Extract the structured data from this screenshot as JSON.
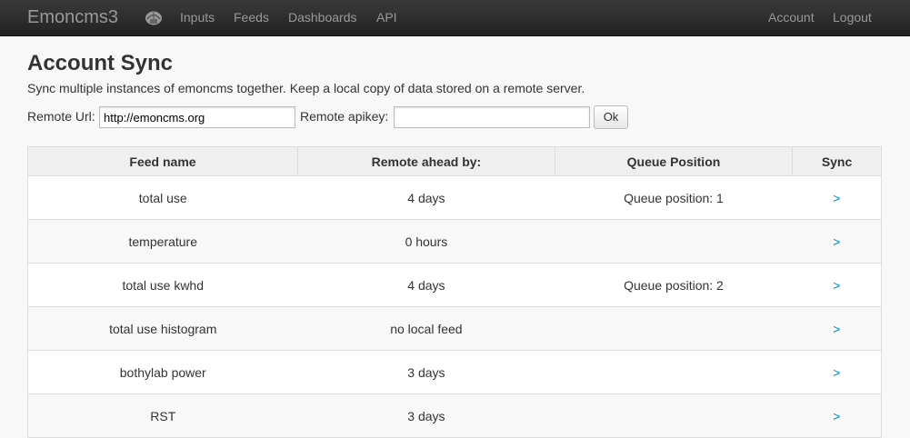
{
  "navbar": {
    "brand": "Emoncms3",
    "logo_icon": "helmet-icon",
    "links": [
      "Inputs",
      "Feeds",
      "Dashboards",
      "API"
    ],
    "right_links": [
      "Account",
      "Logout"
    ]
  },
  "page": {
    "title": "Account Sync",
    "subtitle": "Sync multiple instances of emoncms together. Keep a local copy of data stored on a remote server."
  },
  "form": {
    "remote_url_label": "Remote Url:",
    "remote_url_value": "http://emoncms.org",
    "remote_apikey_label": "Remote apikey:",
    "remote_apikey_value": "",
    "ok_label": "Ok"
  },
  "table": {
    "headers": [
      "Feed name",
      "Remote ahead by:",
      "Queue Position",
      "Sync"
    ],
    "rows": [
      {
        "feed": "total use",
        "ahead": "4 days",
        "queue": "Queue position: 1",
        "sync": ">"
      },
      {
        "feed": "temperature",
        "ahead": "0 hours",
        "queue": "",
        "sync": ">"
      },
      {
        "feed": "total use kwhd",
        "ahead": "4 days",
        "queue": "Queue position: 2",
        "sync": ">"
      },
      {
        "feed": "total use histogram",
        "ahead": "no local feed",
        "queue": "",
        "sync": ">"
      },
      {
        "feed": "bothylab power",
        "ahead": "3 days",
        "queue": "",
        "sync": ">"
      },
      {
        "feed": "RST",
        "ahead": "3 days",
        "queue": "",
        "sync": ">"
      }
    ]
  },
  "colors": {
    "navbar_bg": "#222222",
    "link": "#0088cc"
  }
}
